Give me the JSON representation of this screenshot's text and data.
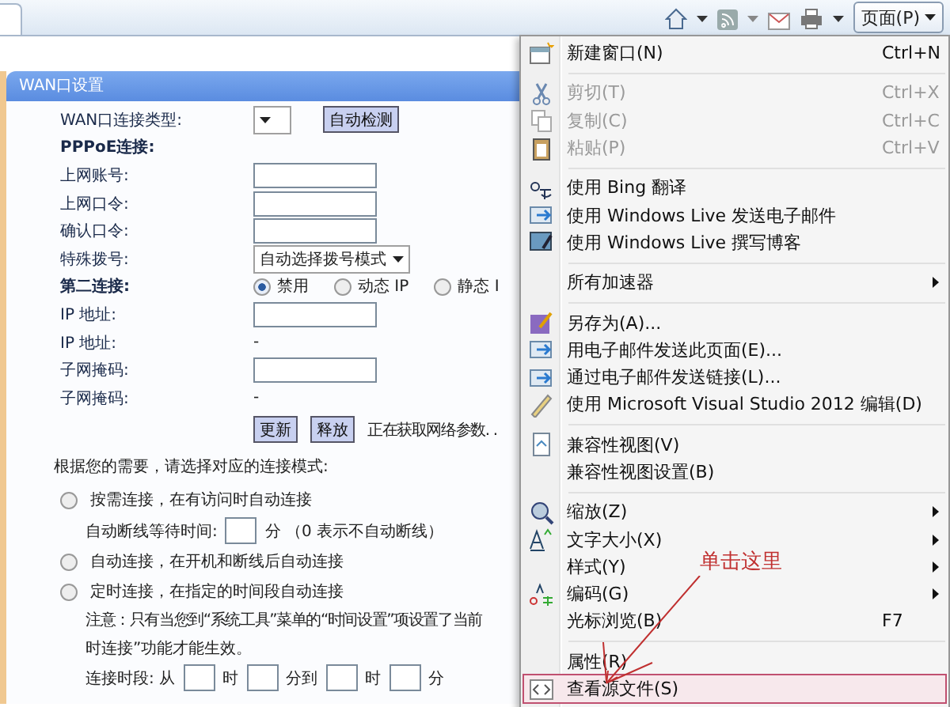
{
  "toolbar": {
    "page_menu": "页面(P)"
  },
  "panel": {
    "title": "WAN口设置",
    "rows": [
      {
        "kind": "type-select",
        "label": "WAN口连接类型:",
        "button": "自动检测"
      },
      {
        "kind": "heading",
        "label": "PPPoE连接:"
      },
      {
        "kind": "input",
        "label": "上网账号:"
      },
      {
        "kind": "input",
        "label": "上网口令:"
      },
      {
        "kind": "input",
        "label": "确认口令:"
      },
      {
        "kind": "dropdown",
        "label": "特殊拨号:",
        "value": "自动选择拨号模式"
      },
      {
        "kind": "radios",
        "label": "第二连接:",
        "options": [
          {
            "label": "禁用",
            "selected": true
          },
          {
            "label": "动态 IP",
            "selected": false
          },
          {
            "label": "静态 I",
            "selected": false
          }
        ]
      },
      {
        "kind": "input",
        "label": "IP 地址:"
      },
      {
        "kind": "value",
        "label": "IP 地址:",
        "value": "-"
      },
      {
        "kind": "input",
        "label": "子网掩码:"
      },
      {
        "kind": "value",
        "label": "子网掩码:",
        "value": "-"
      },
      {
        "kind": "actions",
        "buttons": [
          "更新",
          "释放"
        ],
        "status": "正在获取网络参数. ."
      }
    ],
    "mode_prompt": "根据您的需要，请选择对应的连接模式:",
    "modes": [
      {
        "label": "按需连接，在有访问时自动连接",
        "selected": false,
        "detail": {
          "kind": "wait",
          "before": "自动断线等待时间:",
          "after": "分 （0 表示不自动断线）"
        }
      },
      {
        "label": "自动连接，在开机和断线后自动连接",
        "selected": false
      },
      {
        "label": "定时连接，在指定的时间段自动连接",
        "selected": false,
        "detail": {
          "kind": "schedule",
          "note": "注意：只有当您到“系统工具”菜单的“时间设置”项设置了当前",
          "note_2": "时连接”功能才能生效。",
          "label": "连接时段: 从",
          "units": [
            "时",
            "分到",
            "时",
            "分"
          ]
        }
      }
    ]
  },
  "menu": {
    "items": [
      {
        "kind": "item",
        "label": "新建窗口(N)",
        "shortcut": "Ctrl+N",
        "disabled": false
      },
      {
        "kind": "separator"
      },
      {
        "kind": "item",
        "label": "剪切(T)",
        "shortcut": "Ctrl+X",
        "disabled": true
      },
      {
        "kind": "item",
        "label": "复制(C)",
        "shortcut": "Ctrl+C",
        "disabled": true
      },
      {
        "kind": "item",
        "label": "粘贴(P)",
        "shortcut": "Ctrl+V",
        "disabled": true
      },
      {
        "kind": "separator"
      },
      {
        "kind": "item",
        "label": "使用 Bing 翻译",
        "disabled": false
      },
      {
        "kind": "item",
        "label": "使用 Windows Live 发送电子邮件",
        "disabled": false
      },
      {
        "kind": "item",
        "label": "使用 Windows Live 撰写博客",
        "disabled": false
      },
      {
        "kind": "separator"
      },
      {
        "kind": "item",
        "label": "所有加速器",
        "submenu": true,
        "disabled": false
      },
      {
        "kind": "separator"
      },
      {
        "kind": "item",
        "label": "另存为(A)...",
        "disabled": false
      },
      {
        "kind": "item",
        "label": "用电子邮件发送此页面(E)...",
        "disabled": false
      },
      {
        "kind": "item",
        "label": "通过电子邮件发送链接(L)...",
        "disabled": false
      },
      {
        "kind": "item",
        "label": "使用 Microsoft Visual Studio 2012 编辑(D)",
        "disabled": false
      },
      {
        "kind": "separator"
      },
      {
        "kind": "item",
        "label": "兼容性视图(V)",
        "disabled": false
      },
      {
        "kind": "item",
        "label": "兼容性视图设置(B)",
        "disabled": false
      },
      {
        "kind": "separator"
      },
      {
        "kind": "item",
        "label": "缩放(Z)",
        "submenu": true,
        "disabled": false
      },
      {
        "kind": "item",
        "label": "文字大小(X)",
        "submenu": true,
        "disabled": false
      },
      {
        "kind": "item",
        "label": "样式(Y)",
        "submenu": true,
        "disabled": false
      },
      {
        "kind": "item",
        "label": "编码(G)",
        "submenu": true,
        "disabled": false
      },
      {
        "kind": "item",
        "label": "光标浏览(B)",
        "shortcut": "F7",
        "disabled": false
      },
      {
        "kind": "separator"
      },
      {
        "kind": "item",
        "label": "属性(R)",
        "disabled": false
      },
      {
        "kind": "item",
        "label": "查看源文件(S)",
        "disabled": false,
        "highlighted": true
      }
    ]
  },
  "annotation": {
    "text": "单击这里"
  }
}
